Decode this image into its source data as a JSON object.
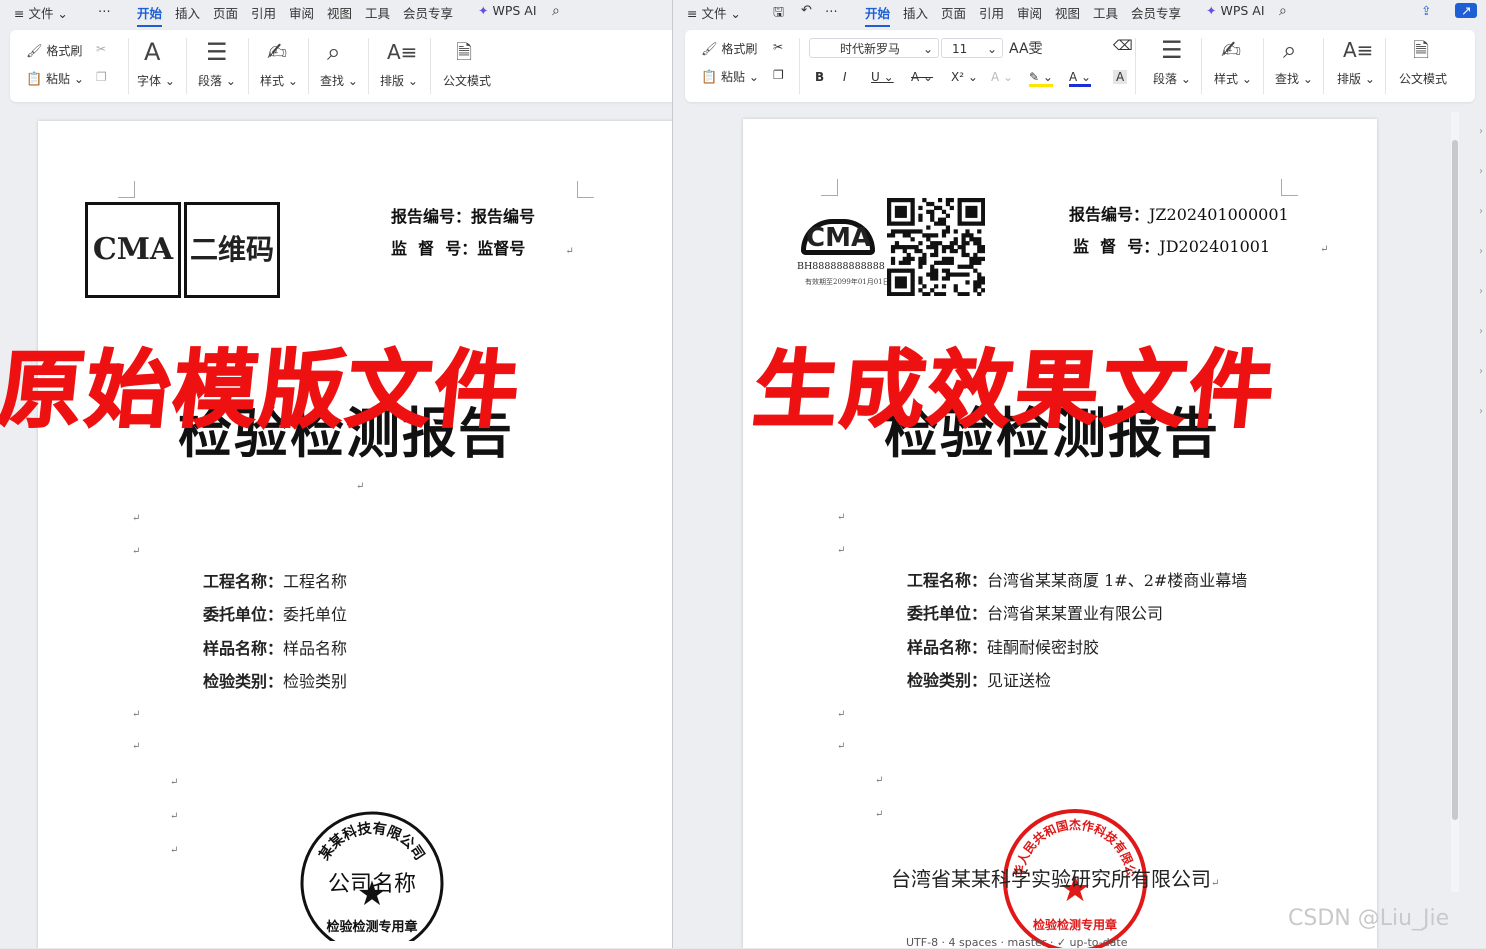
{
  "left": {
    "menu": [
      "≡ 文件 ⌄",
      "⋯",
      "开始",
      "插入",
      "页面",
      "引用",
      "审阅",
      "视图",
      "工具",
      "会员专享",
      "WPS AI"
    ],
    "ribbon": {
      "format_painter": "格式刷",
      "paste": "粘贴",
      "font": "字体",
      "paragraph": "段落",
      "styles": "样式",
      "find": "查找",
      "layout": "排版",
      "official_mode": "公文模式"
    },
    "doc": {
      "cma": "CMA",
      "qr": "二维码",
      "report_no_label": "报告编号：",
      "report_no_value": "报告编号",
      "supervise_label": "监  督  号：",
      "supervise_value": "监督号",
      "title": "检验检测报告",
      "fields": [
        {
          "label": "工程名称：",
          "value": "工程名称"
        },
        {
          "label": "委托单位：",
          "value": "委托单位"
        },
        {
          "label": "样品名称：",
          "value": "样品名称"
        },
        {
          "label": "检验类别：",
          "value": "检验类别"
        }
      ],
      "seal_top": "某某科技有限公司",
      "seal_center": "公司名称",
      "seal_bottom": "检验检测专用章"
    },
    "overlay": "原始模版文件"
  },
  "right": {
    "menu": [
      "≡ 文件 ⌄",
      "⋯",
      "开始",
      "插入",
      "页面",
      "引用",
      "审阅",
      "视图",
      "工具",
      "会员专享",
      "WPS AI"
    ],
    "ribbon": {
      "format_painter": "格式刷",
      "paste": "粘贴",
      "font_name": "时代新罗马",
      "font_size": "11",
      "paragraph": "段落",
      "styles": "样式",
      "find": "查找",
      "layout": "排版",
      "official_mode": "公文模式"
    },
    "doc": {
      "cma_logo": "CMA",
      "cma_number": "BH888888888888",
      "cma_date": "有效期至2099年01月01日",
      "report_no_label": "报告编号：",
      "report_no_value": "JZ202401000001",
      "supervise_label": "监  督  号：",
      "supervise_value": "JD202401001",
      "title": "检验检测报告",
      "fields": [
        {
          "label": "工程名称：",
          "value": "台湾省某某商厦 1#、2#楼商业幕墙"
        },
        {
          "label": "委托单位：",
          "value": "台湾省某某置业有限公司"
        },
        {
          "label": "样品名称：",
          "value": "硅酮耐候密封胶"
        },
        {
          "label": "检验类别：",
          "value": "见证送检"
        }
      ],
      "company": "台湾省某某科学实验研究所有限公司",
      "seal_top": "中华人民共和国杰作科技有限公司",
      "seal_bottom": "检验检测专用章"
    },
    "overlay": "生成效果文件"
  },
  "watermark": "CSDN @Liu_Jie",
  "colors": {
    "accent": "#1f5fd6",
    "overlay": "#ee1111",
    "seal": "#e01818"
  }
}
